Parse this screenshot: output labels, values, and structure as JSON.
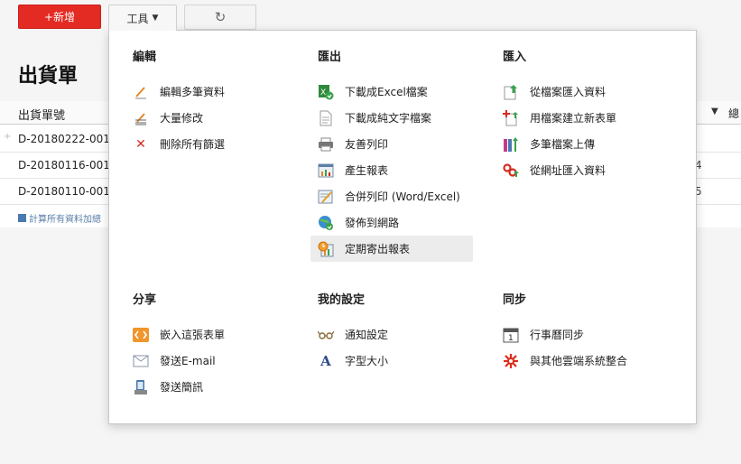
{
  "toolbar": {
    "new_label": "+新增",
    "tools_label": "工具",
    "refresh_icon": "refresh-icon"
  },
  "page": {
    "title": "出貨單",
    "column_header": "出貨單號",
    "column_last": "總",
    "rows": [
      {
        "id": "D-20180222-001",
        "right": ""
      },
      {
        "id": "D-20180116-001",
        "right": "4"
      },
      {
        "id": "D-20180110-001",
        "right": "5"
      }
    ],
    "sum_link": "計算所有資料加總"
  },
  "menu": {
    "edit": {
      "heading": "編輯",
      "items": [
        {
          "label": "編輯多筆資料",
          "icon": "pencil-icon"
        },
        {
          "label": "大量修改",
          "icon": "bulk-edit-icon"
        },
        {
          "label": "刪除所有篩選",
          "icon": "delete-x-icon"
        }
      ]
    },
    "export": {
      "heading": "匯出",
      "items": [
        {
          "label": "下載成Excel檔案",
          "icon": "excel-download-icon"
        },
        {
          "label": "下載成純文字檔案",
          "icon": "text-file-icon"
        },
        {
          "label": "友善列印",
          "icon": "printer-icon"
        },
        {
          "label": "產生報表",
          "icon": "report-icon"
        },
        {
          "label": "合併列印 (Word/Excel)",
          "icon": "merge-print-icon"
        },
        {
          "label": "發佈到網路",
          "icon": "globe-icon"
        },
        {
          "label": "定期寄出報表",
          "icon": "scheduled-report-icon"
        }
      ]
    },
    "import": {
      "heading": "匯入",
      "items": [
        {
          "label": "從檔案匯入資料",
          "icon": "file-import-icon"
        },
        {
          "label": "用檔案建立新表單",
          "icon": "new-form-icon"
        },
        {
          "label": "多筆檔案上傳",
          "icon": "multi-upload-icon"
        },
        {
          "label": "從網址匯入資料",
          "icon": "url-link-icon"
        }
      ]
    },
    "share": {
      "heading": "分享",
      "items": [
        {
          "label": "嵌入這張表單",
          "icon": "embed-code-icon"
        },
        {
          "label": "發送E-mail",
          "icon": "envelope-icon"
        },
        {
          "label": "發送簡訊",
          "icon": "sms-phone-icon"
        }
      ]
    },
    "settings": {
      "heading": "我的設定",
      "items": [
        {
          "label": "通知設定",
          "icon": "glasses-icon"
        },
        {
          "label": "字型大小",
          "icon": "font-size-icon"
        }
      ]
    },
    "sync": {
      "heading": "同步",
      "items": [
        {
          "label": "行事曆同步",
          "icon": "calendar-icon"
        },
        {
          "label": "與其他雲端系統整合",
          "icon": "integration-gear-icon"
        }
      ]
    }
  }
}
